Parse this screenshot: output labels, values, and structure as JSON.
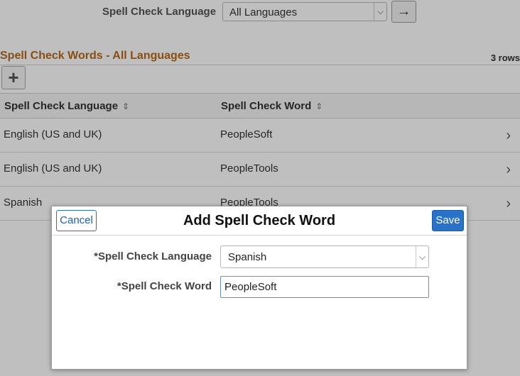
{
  "filter": {
    "label": "Spell Check Language",
    "selected": "All Languages",
    "go_icon": "arrow-right-icon"
  },
  "grid": {
    "title": "Spell Check Words - All Languages",
    "rows_count": "3 rows",
    "add_icon": "plus-icon",
    "columns": [
      "Spell Check Language",
      "Spell Check Word"
    ],
    "rows": [
      {
        "language": "English (US and UK)",
        "word": "PeopleSoft"
      },
      {
        "language": "English (US and UK)",
        "word": "PeopleTools"
      },
      {
        "language": "Spanish",
        "word": "PeopleTools"
      }
    ]
  },
  "modal": {
    "title": "Add Spell Check Word",
    "cancel_label": "Cancel",
    "save_label": "Save",
    "language_label": "*Spell Check Language",
    "language_value": "Spanish",
    "word_label": "*Spell Check Word",
    "word_value": "PeopleSoft"
  },
  "colors": {
    "grid_title": "#b46a1e",
    "save_button": "#2a72c8",
    "cancel_border": "#2a6fbf",
    "overlay": "rgba(0,0,0,0.25)"
  }
}
